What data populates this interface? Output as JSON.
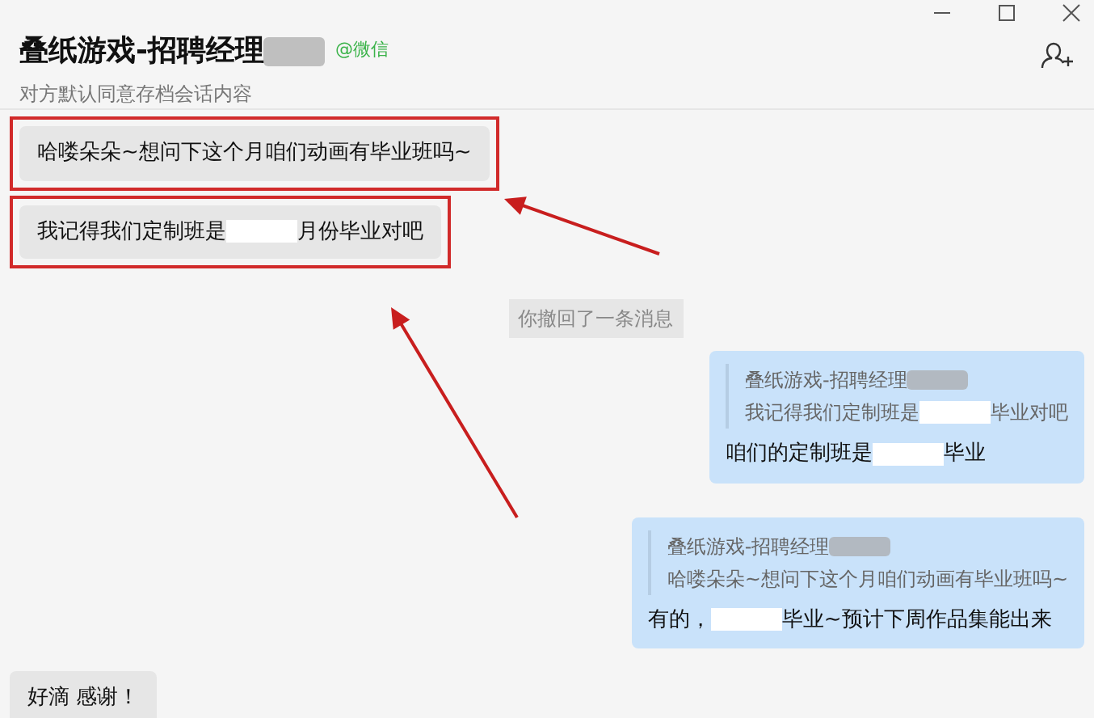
{
  "header": {
    "title": [
      {
        "text": "叠纸游戏-招聘经理"
      },
      {
        "kind": "blur"
      }
    ],
    "tag": "@微信",
    "subtitle": "对方默认同意存档会话内容"
  },
  "messages": [
    {
      "kind": "incoming",
      "highlighted": true,
      "segments": [
        {
          "text": "哈喽朵朵~想问下这个月咱们动画有毕业班吗~"
        }
      ]
    },
    {
      "kind": "incoming",
      "highlighted": true,
      "segments": [
        {
          "text": "我记得我们定制班是"
        },
        {
          "kind": "blank"
        },
        {
          "text": "月份毕业对吧"
        }
      ]
    },
    {
      "kind": "notice",
      "highlighted": false,
      "segments": [
        {
          "text": "你撤回了一条消息"
        }
      ]
    },
    {
      "kind": "outgoing",
      "highlighted": false,
      "quote": {
        "name": [
          {
            "text": "叠纸游戏-招聘经理"
          },
          {
            "kind": "blur"
          }
        ],
        "text": [
          {
            "text": "我记得我们定制班是"
          },
          {
            "kind": "blank"
          },
          {
            "text": "毕业对吧"
          }
        ]
      },
      "segments": [
        {
          "text": "咱们的定制班是"
        },
        {
          "kind": "blank"
        },
        {
          "text": "毕业"
        }
      ]
    },
    {
      "kind": "outgoing",
      "highlighted": false,
      "quote": {
        "name": [
          {
            "text": "叠纸游戏-招聘经理"
          },
          {
            "kind": "blur"
          }
        ],
        "text": [
          {
            "text": "哈喽朵朵~想问下这个月咱们动画有毕业班吗~"
          }
        ]
      },
      "segments": [
        {
          "text": "有的，"
        },
        {
          "kind": "blank"
        },
        {
          "text": "毕业~预计下周作品集能出来"
        }
      ]
    },
    {
      "kind": "incoming",
      "highlighted": false,
      "segments": [
        {
          "text": "好滴 感谢！"
        }
      ]
    }
  ]
}
